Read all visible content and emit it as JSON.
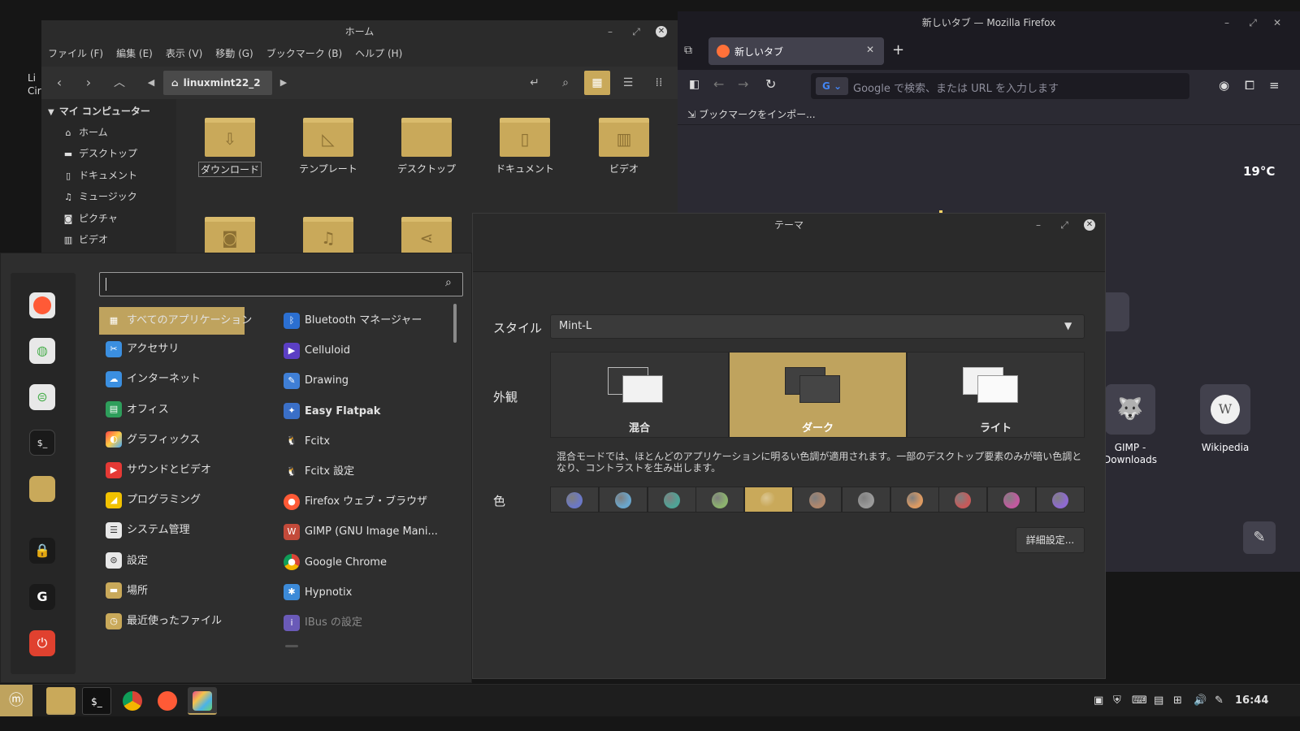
{
  "desktop": {
    "left_text": "Li\nCir"
  },
  "file_manager": {
    "title": "ホーム",
    "menus": [
      "ファイル (F)",
      "編集 (E)",
      "表示 (V)",
      "移動 (G)",
      "ブックマーク (B)",
      "ヘルプ (H)"
    ],
    "path": "linuxmint22_2",
    "sidebar_header": "マイ コンピューター",
    "sidebar": [
      "ホーム",
      "デスクトップ",
      "ドキュメント",
      "ミュージック",
      "ピクチャ",
      "ビデオ"
    ],
    "folders": [
      "ダウンロード",
      "テンプレート",
      "デスクトップ",
      "ドキュメント",
      "ビデオ"
    ]
  },
  "firefox": {
    "title": "新しいタブ — Mozilla Firefox",
    "tab_label": "新しいタブ",
    "url_placeholder": "Google で検索、または URL を入力します",
    "bookmark": "ブックマークをインポー...",
    "weather": "19°C",
    "shortcuts": [
      {
        "label": "GIMP - Downloads"
      },
      {
        "label": "Wikipedia"
      }
    ]
  },
  "theme": {
    "title": "テーマ",
    "style_label": "スタイル",
    "style_value": "Mint-L",
    "appearance_label": "外観",
    "appearance_options": [
      "混合",
      "ダーク",
      "ライト"
    ],
    "appearance_selected": "ダーク",
    "description": "混合モードでは、ほとんどのアプリケーションに明るい色調が適用されます。一部のデスクトップ要素のみが暗い色調となり、コントラストを生み出します。",
    "color_label": "色",
    "colors": [
      "#6b78c6",
      "#6aa6cc",
      "#4fa396",
      "#8cb26e",
      "#c9a95a",
      "#b0876c",
      "#9a9a9a",
      "#dc9a62",
      "#c65a5a",
      "#c25aa0",
      "#8e6ad0"
    ],
    "selected_color": "#c9a95a",
    "advanced_button": "詳細設定..."
  },
  "menu": {
    "search_value": "",
    "categories": [
      "すべてのアプリケーション",
      "アクセサリ",
      "インターネット",
      "オフィス",
      "グラフィックス",
      "サウンドとビデオ",
      "プログラミング",
      "システム管理",
      "設定",
      "場所",
      "最近使ったファイル"
    ],
    "apps": [
      "Bluetooth マネージャー",
      "Celluloid",
      "Drawing",
      "Easy Flatpak",
      "Fcitx",
      "Fcitx 設定",
      "Firefox ウェブ・ブラウザ",
      "GIMP (GNU Image Mani...",
      "Google Chrome",
      "Hypnotix",
      "IBus の設定"
    ]
  },
  "taskbar": {
    "clock": "16:44"
  }
}
